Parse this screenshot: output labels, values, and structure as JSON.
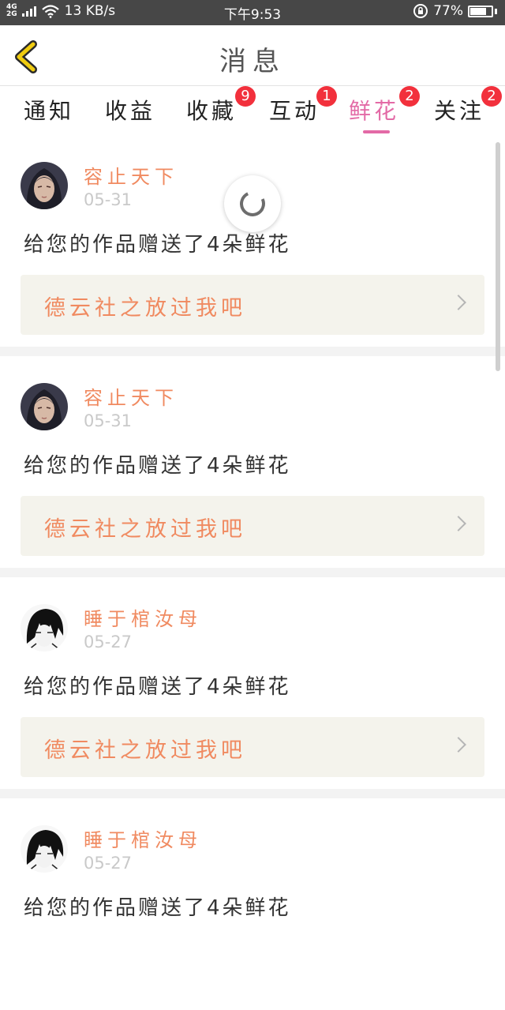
{
  "status_bar": {
    "network_top": "4G",
    "network_bottom": "2G",
    "speed": "13 KB/s",
    "time": "下午9:53",
    "battery": "77%",
    "battery_level": 0.77
  },
  "header": {
    "title": "消息",
    "back_icon": "chevron-left-icon",
    "back_color": "#e8c000"
  },
  "tabs": [
    {
      "label": "通知",
      "badge": ""
    },
    {
      "label": "收益",
      "badge": ""
    },
    {
      "label": "收藏",
      "badge": "9"
    },
    {
      "label": "互动",
      "badge": "1"
    },
    {
      "label": "鲜花",
      "badge": "2",
      "active": true
    },
    {
      "label": "关注",
      "badge": "2"
    }
  ],
  "accent_color": "#e36aa6",
  "feed": [
    {
      "user": "容止天下",
      "date": "05-31",
      "message": "给您的作品赠送了4朵鲜花",
      "work": "德云社之放过我吧",
      "avatar": "avatar-warrior"
    },
    {
      "user": "容止天下",
      "date": "05-31",
      "message": "给您的作品赠送了4朵鲜花",
      "work": "德云社之放过我吧",
      "avatar": "avatar-warrior"
    },
    {
      "user": "睡于棺汝母",
      "date": "05-27",
      "message": "给您的作品赠送了4朵鲜花",
      "work": "德云社之放过我吧",
      "avatar": "avatar-sketch"
    },
    {
      "user": "睡于棺汝母",
      "date": "05-27",
      "message": "给您的作品赠送了4朵鲜花",
      "work": "",
      "avatar": "avatar-sketch"
    }
  ]
}
